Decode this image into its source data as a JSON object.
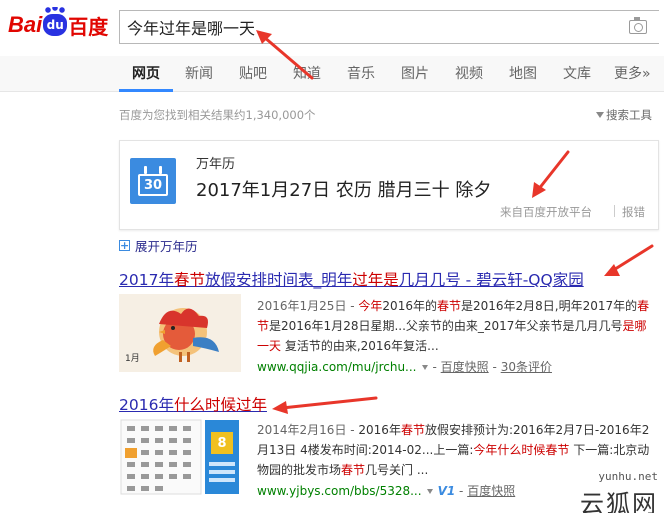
{
  "logo": {
    "bai": "Bai",
    "du": "du",
    "cn": "百度"
  },
  "search": {
    "value": "今年过年是哪一天"
  },
  "nav": {
    "items": [
      "网页",
      "新闻",
      "贴吧",
      "知道",
      "音乐",
      "图片",
      "视频",
      "地图",
      "文库",
      "更多»"
    ],
    "active": "网页"
  },
  "result_count": "百度为您找到相关结果约1,340,000个",
  "search_tools": "搜索工具",
  "calendar_card": {
    "icon_day": "30",
    "title": "万年历",
    "date_line": "2017年1月27日 农历 腊月三十 除夕",
    "source": "来自百度开放平台",
    "report": "报错"
  },
  "expand_calendar": "展开万年历",
  "results": [
    {
      "title_parts": [
        {
          "t": "2017年",
          "em": false
        },
        {
          "t": "春节",
          "em": true
        },
        {
          "t": "放假安排时间表_明年",
          "em": false
        },
        {
          "t": "过年是",
          "em": true
        },
        {
          "t": "几月几号 - 碧云轩-QQ家园",
          "em": false
        }
      ],
      "thumb_label": "1月",
      "desc_parts": [
        {
          "t": "2016年1月25日 - ",
          "cls": "date"
        },
        {
          "t": "今年",
          "cls": "em"
        },
        {
          "t": "2016年的",
          "cls": ""
        },
        {
          "t": "春节",
          "cls": "em"
        },
        {
          "t": "是2016年2月8日,明年2017年的",
          "cls": ""
        },
        {
          "t": "春节",
          "cls": "em"
        },
        {
          "t": "是2016年1月28日星期...父亲节的由来_2017年父亲节是几月几号",
          "cls": ""
        },
        {
          "t": "是哪一天",
          "cls": "em"
        },
        {
          "t": " 复活节的由来,2016年复活...",
          "cls": ""
        }
      ],
      "url": "www.qqjia.com/mu/jrchu...",
      "snapshot": "百度快照",
      "extra": "30条评价"
    },
    {
      "title_parts": [
        {
          "t": "2016年",
          "em": false
        },
        {
          "t": "什么时候过年",
          "em": true
        }
      ],
      "thumb_day": "8",
      "desc_parts": [
        {
          "t": "2014年2月16日 - ",
          "cls": "date"
        },
        {
          "t": "2016年",
          "cls": ""
        },
        {
          "t": "春节",
          "cls": "em"
        },
        {
          "t": "放假安排预计为:2016年2月7日-2016年2月13日 4楼发布时间:2014-02...上一篇:",
          "cls": ""
        },
        {
          "t": "今年什么时候春节",
          "cls": "em"
        },
        {
          "t": " 下一篇:北京动物园的批发市场",
          "cls": ""
        },
        {
          "t": "春节",
          "cls": "em"
        },
        {
          "t": "几号关门 ...",
          "cls": ""
        }
      ],
      "url": "www.yjbys.com/bbs/5328...",
      "badge": "V1",
      "snapshot": "百度快照"
    }
  ],
  "watermark": {
    "url": "yunhu.net",
    "brand": "云狐网"
  },
  "colors": {
    "accent": "#3388ff",
    "logo_red": "#e10601",
    "link": "#2a2ab0",
    "highlight": "#cc0000",
    "url_green": "#008000",
    "annotation_red": "#e8362a"
  }
}
